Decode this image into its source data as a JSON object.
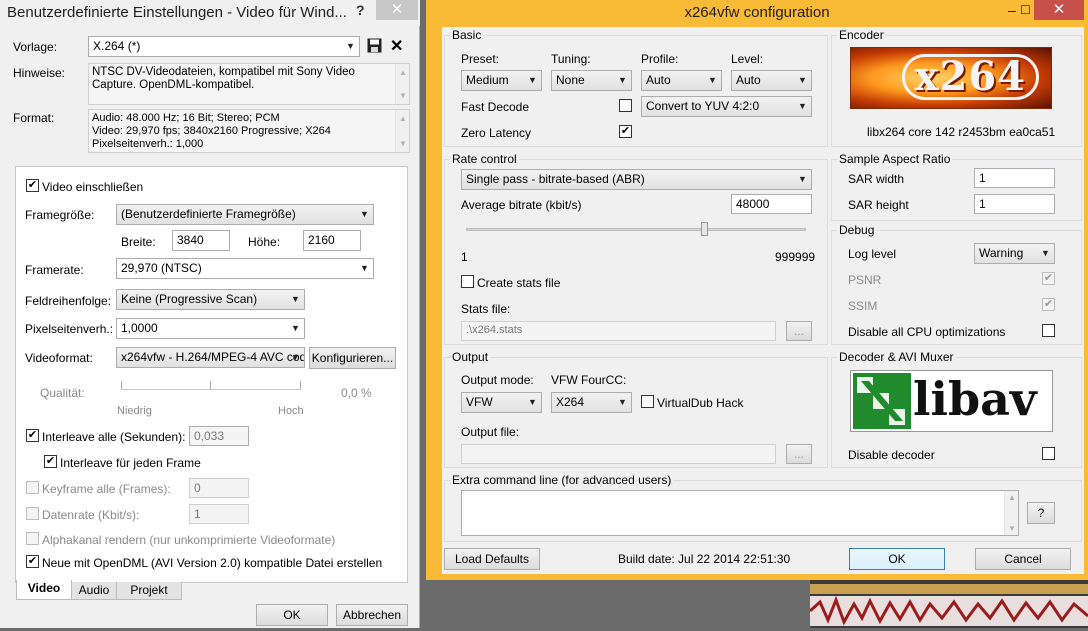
{
  "left_dialog": {
    "title": "Benutzerdefinierte Einstellungen - Video für Wind...",
    "help": "?",
    "close": "✕",
    "vorlage_label": "Vorlage:",
    "vorlage_value": "X.264 (*)",
    "hinweise_label": "Hinweise:",
    "hinweise_text": "NTSC DV-Videodateien, kompatibel mit Sony Video Capture. OpenDML-kompatibel.",
    "format_label": "Format:",
    "format_line1": "Audio: 48.000 Hz; 16 Bit; Stereo; PCM",
    "format_line2": "Video: 29,970 fps; 3840x2160 Progressive; X264",
    "format_line3": "Pixelseitenverh.: 1,000",
    "video_einschliessen": "Video einschließen",
    "framegroesse_label": "Framegröße:",
    "framegroesse_value": "(Benutzerdefinierte Framegröße)",
    "breite_label": "Breite:",
    "breite_value": "3840",
    "hoehe_label": "Höhe:",
    "hoehe_value": "2160",
    "framerate_label": "Framerate:",
    "framerate_value": "29,970 (NTSC)",
    "feldreihenfolge_label": "Feldreihenfolge:",
    "feldreihenfolge_value": "Keine (Progressive Scan)",
    "pixelseitenverh_label": "Pixelseitenverh.:",
    "pixelseitenverh_value": "1,0000",
    "videoformat_label": "Videoformat:",
    "videoformat_value": "x264vfw - H.264/MPEG-4 AVC cod",
    "konfigurieren": "Konfigurieren...",
    "qualitaet_label": "Qualität:",
    "qualitaet_value": "0,0 %",
    "niedrig": "Niedrig",
    "hoch": "Hoch",
    "interleave_alle": "Interleave alle (Sekunden):",
    "interleave_value": "0,033",
    "interleave_jeden_frame": "Interleave für jeden Frame",
    "keyframe_alle": "Keyframe alle (Frames):",
    "keyframe_value": "0",
    "datenrate": "Datenrate (Kbit/s):",
    "datenrate_value": "1",
    "alphakanal": "Alphakanal rendern (nur unkomprimierte Videoformate)",
    "opendml": "Neue mit OpenDML (AVI Version 2.0) kompatible Datei erstellen",
    "tabs": [
      "Video",
      "Audio",
      "Projekt"
    ],
    "ok": "OK",
    "abbrechen": "Abbrechen"
  },
  "x264": {
    "title": "x264vfw configuration",
    "close": "✕",
    "basic": {
      "group": "Basic",
      "preset_label": "Preset:",
      "preset_value": "Medium",
      "tuning_label": "Tuning:",
      "tuning_value": "None",
      "profile_label": "Profile:",
      "profile_value": "Auto",
      "level_label": "Level:",
      "level_value": "Auto",
      "fast_decode": "Fast Decode",
      "zero_latency": "Zero Latency",
      "color_convert": "Convert to YUV 4:2:0"
    },
    "encoder": {
      "group": "Encoder",
      "version": "libx264 core 142 r2453bm ea0ca51",
      "logo_text": "x264"
    },
    "rate_control": {
      "group": "Rate control",
      "mode": "Single pass - bitrate-based (ABR)",
      "avg_bitrate_label": "Average bitrate (kbit/s)",
      "avg_bitrate_value": "48000",
      "min": "1",
      "max": "999999",
      "slider_fraction": 0.7,
      "create_stats": "Create stats file",
      "stats_file_label": "Stats file:",
      "stats_file_value": ".\\x264.stats",
      "browse": "..."
    },
    "sar": {
      "group": "Sample Aspect Ratio",
      "width_label": "SAR width",
      "width_value": "1",
      "height_label": "SAR height",
      "height_value": "1"
    },
    "debug": {
      "group": "Debug",
      "log_level_label": "Log level",
      "log_level_value": "Warning",
      "psnr": "PSNR",
      "ssim": "SSIM",
      "disable_cpu": "Disable all CPU optimizations"
    },
    "output": {
      "group": "Output",
      "mode_label": "Output mode:",
      "mode_value": "VFW",
      "fourcc_label": "VFW FourCC:",
      "fourcc_value": "X264",
      "virtualdub_hack": "VirtualDub Hack",
      "output_file_label": "Output file:",
      "browse": "..."
    },
    "decoder": {
      "group": "Decoder & AVI Muxer",
      "disable_decoder": "Disable decoder",
      "logo_text": "libav"
    },
    "extra": {
      "group": "Extra command line (for advanced users)",
      "help": "?"
    },
    "load_defaults": "Load Defaults",
    "build_date": "Build date: Jul 22 2014 22:51:30",
    "ok": "OK",
    "cancel": "Cancel"
  },
  "colors": {
    "window_accent": "#f9ba35",
    "close_red": "#c7504a",
    "libav_green": "#1f8b2c"
  }
}
